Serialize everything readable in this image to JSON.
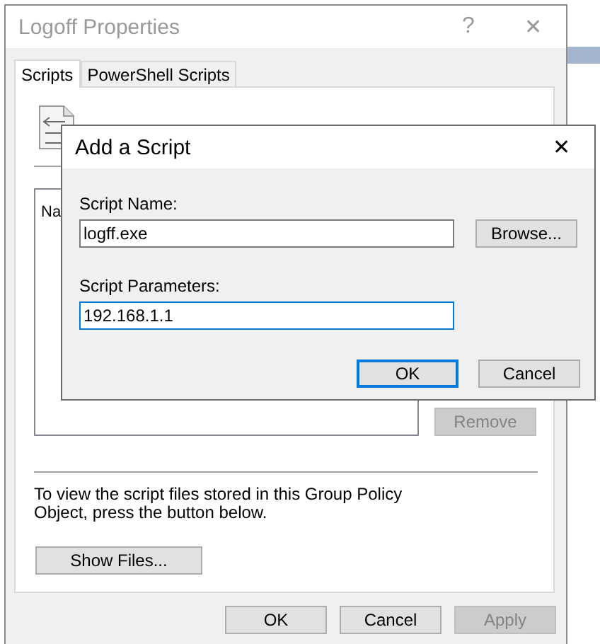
{
  "properties_window": {
    "title": "Logoff Properties",
    "help": "?",
    "close": "✕",
    "tabs": [
      {
        "label": "Scripts",
        "selected": true
      },
      {
        "label": "PowerShell Scripts",
        "selected": false
      }
    ],
    "list": {
      "column_1": "Na"
    },
    "remove_button": {
      "label": "Remove",
      "disabled": true
    },
    "note": "To view the script files stored in this Group Policy Object, press the button below.",
    "show_files_button": {
      "label": "Show Files..."
    },
    "buttons": [
      {
        "label": "OK",
        "disabled": false
      },
      {
        "label": "Cancel",
        "disabled": false
      },
      {
        "label": "Apply",
        "disabled": true
      }
    ]
  },
  "add_script_dialog": {
    "title": "Add a Script",
    "close": "✕",
    "fields": [
      {
        "label": "Script Name:",
        "value": "logff.exe",
        "focused": false
      },
      {
        "label": "Script Parameters:",
        "value": "192.168.1.1",
        "focused": true
      }
    ],
    "browse_button": {
      "label": "Browse..."
    },
    "buttons": [
      {
        "label": "OK",
        "default": true
      },
      {
        "label": "Cancel",
        "default": false
      }
    ]
  }
}
